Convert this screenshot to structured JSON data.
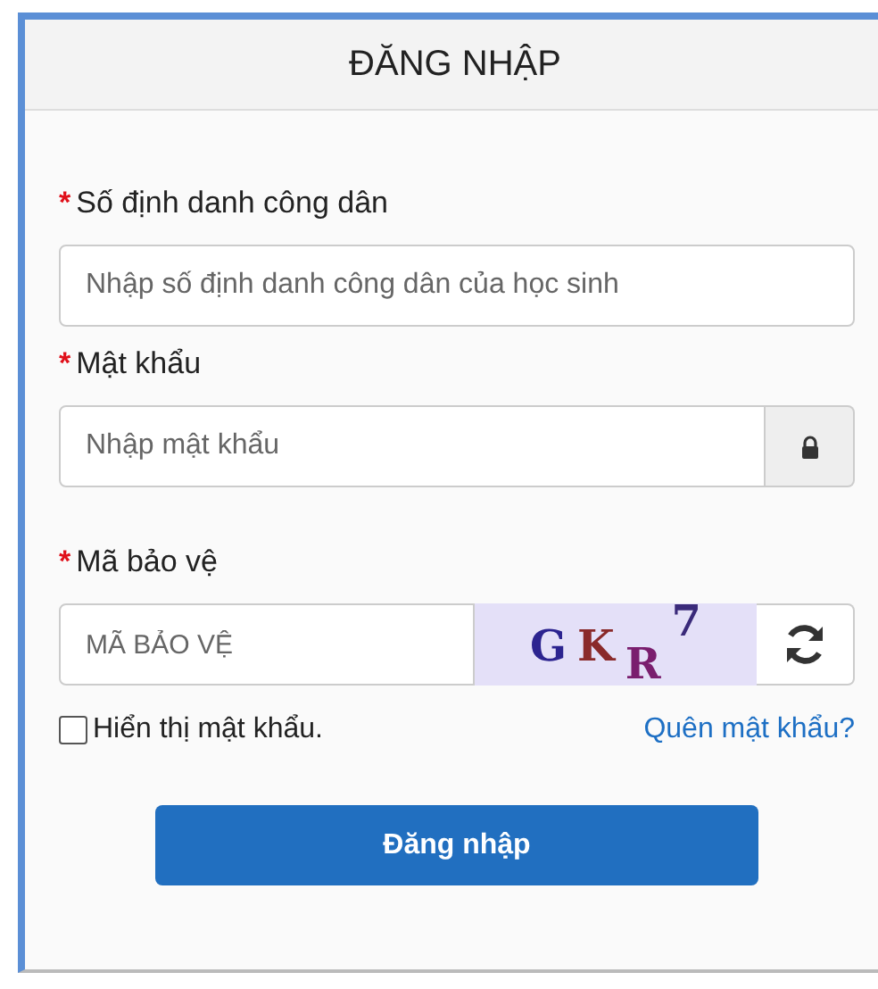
{
  "title": "ĐĂNG NHẬP",
  "fields": [
    {
      "kind": "text",
      "label": "Số định danh công dân",
      "required_mark": "*",
      "placeholder": "Nhập số định danh công dân của học sinh"
    },
    {
      "kind": "password",
      "label": "Mật khẩu",
      "required_mark": "*",
      "placeholder": "Nhập mật khẩu"
    },
    {
      "kind": "captcha",
      "label": "Mã bảo vệ",
      "required_mark": "*",
      "placeholder": "MÃ BẢO VỆ",
      "captcha": [
        {
          "text": "G",
          "color": "#2c2490"
        },
        {
          "text": "K",
          "color": "#8a2a2a"
        },
        {
          "text": "R",
          "color": "#7a1e6e"
        },
        {
          "text": "7",
          "color": "#3a2a7a"
        }
      ]
    }
  ],
  "show_password": {
    "label": "Hiển thị mật khẩu.",
    "checked": false
  },
  "forgot_link": "Quên mật khẩu?",
  "submit": "Đăng nhập"
}
